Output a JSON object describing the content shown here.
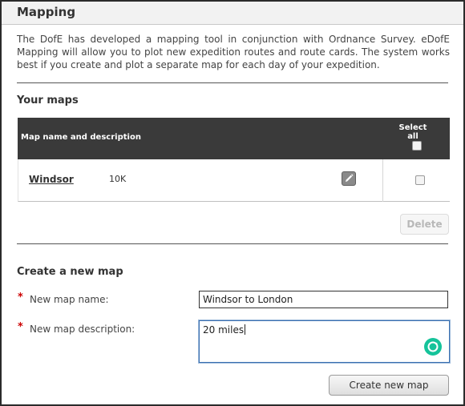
{
  "header": {
    "title": "Mapping"
  },
  "intro": {
    "text": "The DofE has developed a mapping tool in conjunction with Ordnance Survey. eDofE Mapping will allow you to plot new expedition routes and route cards. The system works best if you create and plot a separate map for each day of your expedition."
  },
  "your_maps": {
    "title": "Your maps",
    "table": {
      "columns": [
        "Map name and description",
        "Select all"
      ],
      "rows": [
        {
          "name": "Windsor",
          "description": "10K",
          "edit_icon": "pencil-icon",
          "selected": false
        }
      ]
    },
    "delete_label": "Delete"
  },
  "create_map": {
    "title": "Create a new map",
    "required_marker": "*",
    "name_label": "New map name:",
    "name_value": "Windsor to London",
    "description_label": "New map description:",
    "description_value": "20 miles",
    "submit_label": "Create new map"
  },
  "colors": {
    "header_bg": "#3a3a3a",
    "required": "#cc0000",
    "grammar_icon": "#15c39a"
  }
}
